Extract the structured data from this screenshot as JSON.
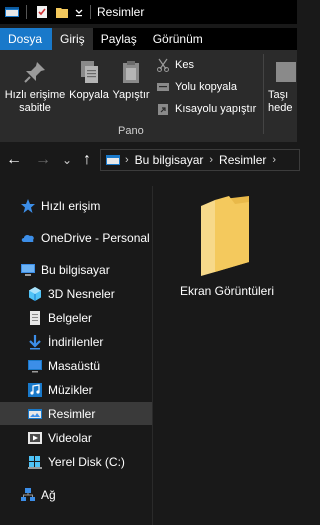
{
  "window": {
    "title": "Resimler"
  },
  "ribbon_tabs": [
    "Dosya",
    "Giriş",
    "Paylaş",
    "Görünüm"
  ],
  "ribbon": {
    "pin_label_line1": "Hızlı erişime",
    "pin_label_line2": "sabitle",
    "copy_label": "Kopyala",
    "paste_label": "Yapıştır",
    "cut_label": "Kes",
    "copy_path_label": "Yolu kopyala",
    "paste_shortcut_label": "Kısayolu yapıştır",
    "move_label_line1": "Taşı",
    "move_label_line2": "hede",
    "group_label": "Pano"
  },
  "navigation": {
    "back_glyph": "←",
    "forward_glyph": "→",
    "recent_glyph": "⌄",
    "up_glyph": "↑"
  },
  "address": {
    "crumbs": [
      "Bu bilgisayar",
      "Resimler"
    ],
    "separator": "›"
  },
  "nav_pane": {
    "quick_access": "Hızlı erişim",
    "onedrive": "OneDrive - Personal",
    "this_pc": "Bu bilgisayar",
    "items": [
      {
        "label": "3D Nesneler",
        "icon": "3d-objects-icon"
      },
      {
        "label": "Belgeler",
        "icon": "documents-icon"
      },
      {
        "label": "İndirilenler",
        "icon": "downloads-icon"
      },
      {
        "label": "Masaüstü",
        "icon": "desktop-icon"
      },
      {
        "label": "Müzikler",
        "icon": "music-icon"
      },
      {
        "label": "Resimler",
        "icon": "pictures-icon",
        "selected": true
      },
      {
        "label": "Videolar",
        "icon": "videos-icon"
      },
      {
        "label": "Yerel Disk (C:)",
        "icon": "local-disk-icon"
      }
    ],
    "network": "Ağ"
  },
  "content": {
    "items": [
      {
        "label": "Ekran Görüntüleri",
        "icon": "folder-icon"
      }
    ]
  },
  "colors": {
    "accent": "#1979ca",
    "folder": "#f4c95d",
    "selected": "#3a3a3a"
  }
}
